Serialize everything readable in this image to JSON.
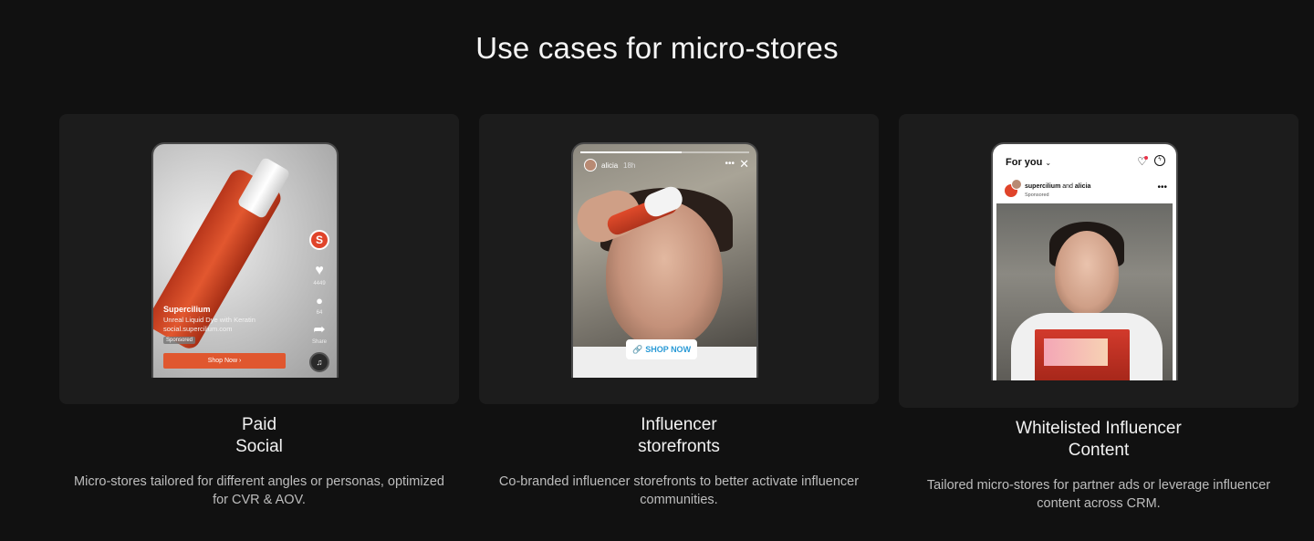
{
  "section": {
    "title": "Use cases for micro-stores"
  },
  "cards": [
    {
      "title_line1": "Paid",
      "title_line2": "Social",
      "description": "Micro-stores tailored for different angles or personas, optimized for CVR & AOV.",
      "mock": {
        "brand": "Supercilium",
        "product": "Unreal Liquid Dye with Keratin",
        "url": "social.supercilium.com",
        "sponsored": "Sponsored",
        "cta": "Shop Now  ›",
        "likes": "4449",
        "comments": "64",
        "share": "Share",
        "icons": [
          "brand-logo-icon",
          "heart-icon",
          "comment-icon",
          "share-icon",
          "music-disc-icon"
        ]
      }
    },
    {
      "title_line1": "Influencer",
      "title_line2": "storefronts",
      "description": "Co-branded influencer storefronts to better activate influencer communities.",
      "mock": {
        "user": "alicia",
        "time": "18h",
        "cta": "SHOP NOW",
        "icons": [
          "more-icon",
          "close-icon",
          "link-icon"
        ]
      }
    },
    {
      "title_line1": "Whitelisted Influencer",
      "title_line2": "Content",
      "description": "Tailored micro-stores for partner ads or leverage influencer content across CRM.",
      "mock": {
        "feed_title": "For you",
        "account1": "supercilium",
        "joiner": "and",
        "account2": "alicia",
        "sponsored": "Sponsored",
        "icons": [
          "heart-icon",
          "messenger-icon",
          "more-icon"
        ]
      }
    }
  ],
  "colors": {
    "background": "#111111",
    "card": "#1c1c1c",
    "accent": "#e0572f",
    "link_blue": "#2a9ad6"
  }
}
